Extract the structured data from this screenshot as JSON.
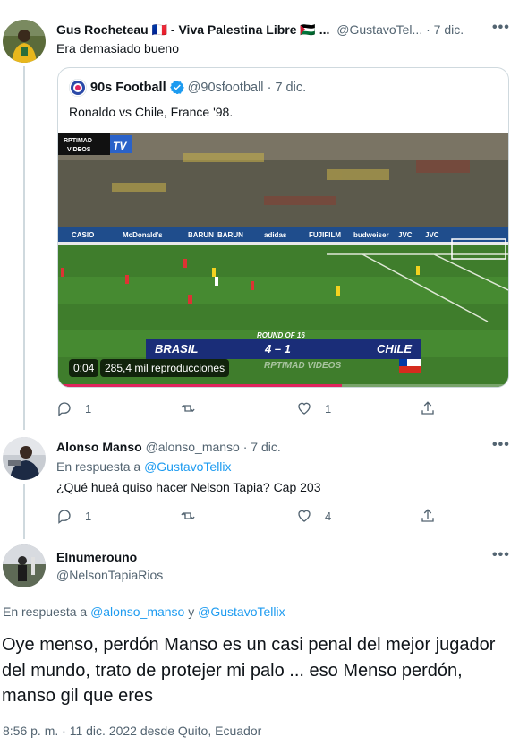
{
  "tweet1": {
    "author_name": "Gus Rocheteau",
    "flag_fr": "🇫🇷",
    "name_suffix": "- Viva Palestina Libre",
    "flag_ps": "🇵🇸",
    "ellipsis": "...",
    "handle": "@GustavoTel...",
    "separator": "·",
    "time": "7 dic.",
    "more": "•••",
    "text": "Era demasiado bueno",
    "quote": {
      "author_name": "90s Football",
      "handle": "@90sfootball",
      "time": "7 dic.",
      "text": "Ronaldo vs Chile, France '98.",
      "video": {
        "duration": "0:04",
        "views": "285,4 mil reproducciones",
        "progress": 0.63,
        "logo_top": "RPTIMAD",
        "logo_bottom": "VIDEOS",
        "logo_tv": "TV",
        "round": "ROUND OF 16",
        "team_home": "BRASIL",
        "score": "4 – 1",
        "team_away": "CHILE",
        "watermark": "RPTIMAD VIDEOS"
      }
    },
    "replies": "1",
    "retweets": "",
    "likes": "1"
  },
  "tweet2": {
    "author_name": "Alonso Manso",
    "handle": "@alonso_manso",
    "separator": "·",
    "time": "7 dic.",
    "more": "•••",
    "reply_prefix": "En respuesta a",
    "reply_to": "@GustavoTellix",
    "text": "¿Qué hueá quiso hacer Nelson Tapia? Cap 203",
    "replies": "1",
    "retweets": "",
    "likes": "4"
  },
  "tweet3": {
    "author_name": "Elnumerouno",
    "handle": "@NelsonTapiaRios",
    "more": "•••",
    "reply_prefix": "En respuesta a",
    "reply_to_1": "@alonso_manso",
    "reply_joiner": "y",
    "reply_to_2": "@GustavoTellix",
    "text": "Oye menso,  perdón Manso es un casi  penal del mejor jugador del mundo, trato de protejer mi palo ... eso Menso perdón, manso gil que eres",
    "time": "8:56 p. m.",
    "date_sep": "·",
    "date": "11 dic. 2022 desde Quito, Ecuador"
  },
  "colors": {
    "link": "#1d9bf0",
    "muted": "#536471",
    "verified": "#1d9bf0"
  }
}
